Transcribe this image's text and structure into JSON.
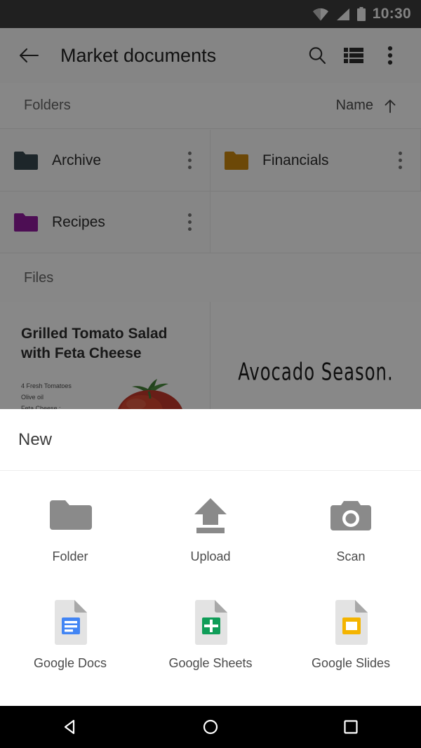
{
  "status_bar": {
    "time": "10:30",
    "icons": [
      "wifi-icon",
      "cellular-signal-icon",
      "battery-icon"
    ]
  },
  "toolbar": {
    "back_icon": "back-arrow-icon",
    "title": "Market documents",
    "actions": [
      {
        "name": "search-icon",
        "label": "Search"
      },
      {
        "name": "list-view-icon",
        "label": "List view"
      },
      {
        "name": "overflow-menu-icon",
        "label": "More options"
      }
    ]
  },
  "sort_row": {
    "section_label": "Folders",
    "sort_field": "Name",
    "sort_direction_icon": "arrow-up-icon"
  },
  "folders": [
    {
      "name": "Archive",
      "color": "#37474f",
      "menu_icon": "overflow-menu-icon"
    },
    {
      "name": "Financials",
      "color": "#c8860d",
      "menu_icon": "overflow-menu-icon"
    },
    {
      "name": "Recipes",
      "color": "#8e1b9c",
      "menu_icon": "overflow-menu-icon"
    }
  ],
  "files_section": {
    "label": "Files",
    "items": [
      {
        "title": "Grilled Tomato Salad with Feta Cheese",
        "ingredients": [
          "4 Fresh Tomatoes",
          "Olive oil",
          "Feta Cheese :"
        ],
        "thumbnail": "tomato-illustration"
      },
      {
        "title": "Avocado Season.",
        "thumbnail": "avocado-season-text"
      }
    ]
  },
  "bottom_sheet": {
    "title": "New",
    "items": [
      {
        "label": "Folder",
        "icon": "folder-icon",
        "color": "#8a8a8a"
      },
      {
        "label": "Upload",
        "icon": "upload-icon",
        "color": "#8a8a8a"
      },
      {
        "label": "Scan",
        "icon": "camera-icon",
        "color": "#8a8a8a"
      },
      {
        "label": "Google Docs",
        "icon": "google-docs-icon",
        "color": "#4285f4"
      },
      {
        "label": "Google Sheets",
        "icon": "google-sheets-icon",
        "color": "#0f9d58"
      },
      {
        "label": "Google Slides",
        "icon": "google-slides-icon",
        "color": "#f4b400"
      }
    ]
  },
  "nav_bar": {
    "buttons": [
      {
        "name": "back-nav-icon",
        "label": "Back"
      },
      {
        "name": "home-nav-icon",
        "label": "Home"
      },
      {
        "name": "recents-nav-icon",
        "label": "Recents"
      }
    ]
  }
}
